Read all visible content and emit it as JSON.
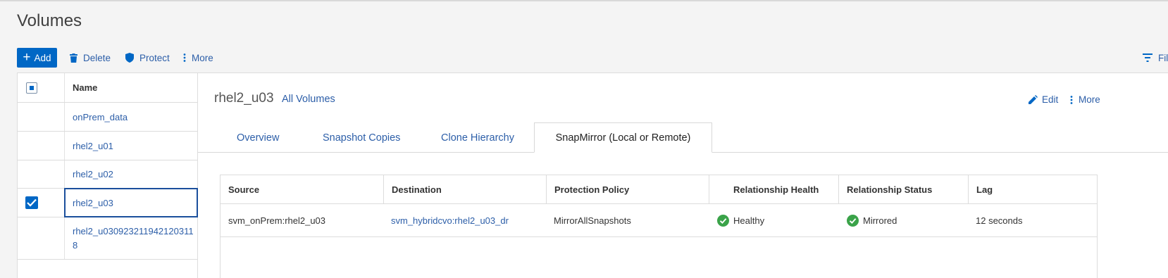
{
  "page": {
    "title": "Volumes"
  },
  "toolbar": {
    "add_label": "Add",
    "delete_label": "Delete",
    "protect_label": "Protect",
    "more_label": "More",
    "filter_label": "Filter"
  },
  "list": {
    "header_name": "Name",
    "rows": [
      {
        "name": "onPrem_data",
        "checked": false
      },
      {
        "name": "rhel2_u01",
        "checked": false
      },
      {
        "name": "rhel2_u02",
        "checked": false
      },
      {
        "name": "rhel2_u03",
        "checked": true
      },
      {
        "name_line1": "rhel2_u030923211942120311",
        "name_line2": "8",
        "checked": false
      }
    ]
  },
  "detail": {
    "volume_name": "rhel2_u03",
    "all_volumes_link": "All Volumes",
    "edit_label": "Edit",
    "more_label": "More",
    "tabs": [
      "Overview",
      "Snapshot Copies",
      "Clone Hierarchy",
      "SnapMirror (Local or Remote)"
    ],
    "active_tab": "SnapMirror (Local or Remote)",
    "table": {
      "headers": [
        "Source",
        "Destination",
        "Protection Policy",
        "Relationship Health",
        "Relationship Status",
        "Lag"
      ],
      "rows": [
        {
          "source": "svm_onPrem:rhel2_u03",
          "destination": "svm_hybridcvo:rhel2_u03_dr",
          "policy": "MirrorAllSnapshots",
          "health": "Healthy",
          "status": "Mirrored",
          "lag": "12 seconds"
        }
      ]
    }
  },
  "colors": {
    "primary": "#0067c5",
    "link": "#2c5ea8",
    "success": "#3aa349"
  },
  "icons": [
    "plus-icon",
    "trash-icon",
    "shield-icon",
    "kebab-icon",
    "filter-icon",
    "pencil-icon",
    "check-circle-icon",
    "checkbox-icon"
  ]
}
